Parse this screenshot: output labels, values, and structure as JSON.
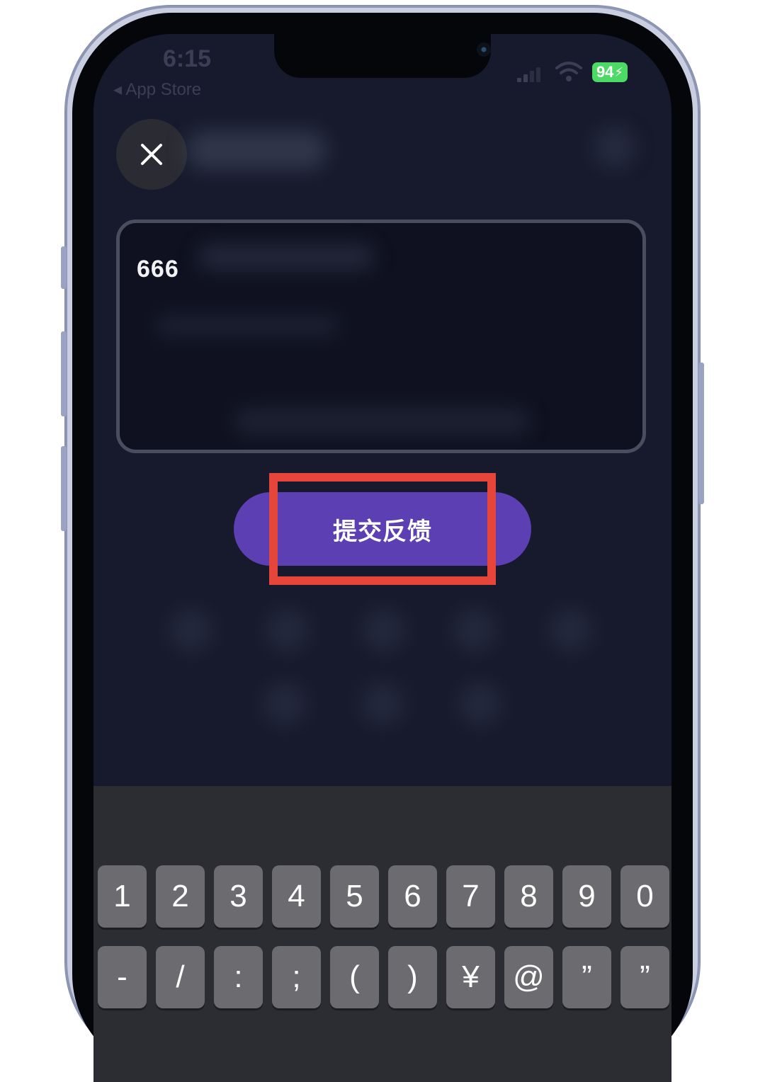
{
  "status_bar": {
    "time": "6:15",
    "back_label": "◂ App Store",
    "battery": "94"
  },
  "feedback": {
    "text": "666"
  },
  "submit": {
    "label": "提交反馈"
  },
  "keyboard": {
    "row1": [
      "1",
      "2",
      "3",
      "4",
      "5",
      "6",
      "7",
      "8",
      "9",
      "0"
    ],
    "row2": [
      "-",
      "/",
      ":",
      ";",
      "(",
      ")",
      "¥",
      "@",
      "”",
      "”"
    ]
  },
  "colors": {
    "accent": "#5c3fb2",
    "highlight": "#e6453a",
    "battery": "#4cd964",
    "screen_bg": "#161a2c"
  }
}
